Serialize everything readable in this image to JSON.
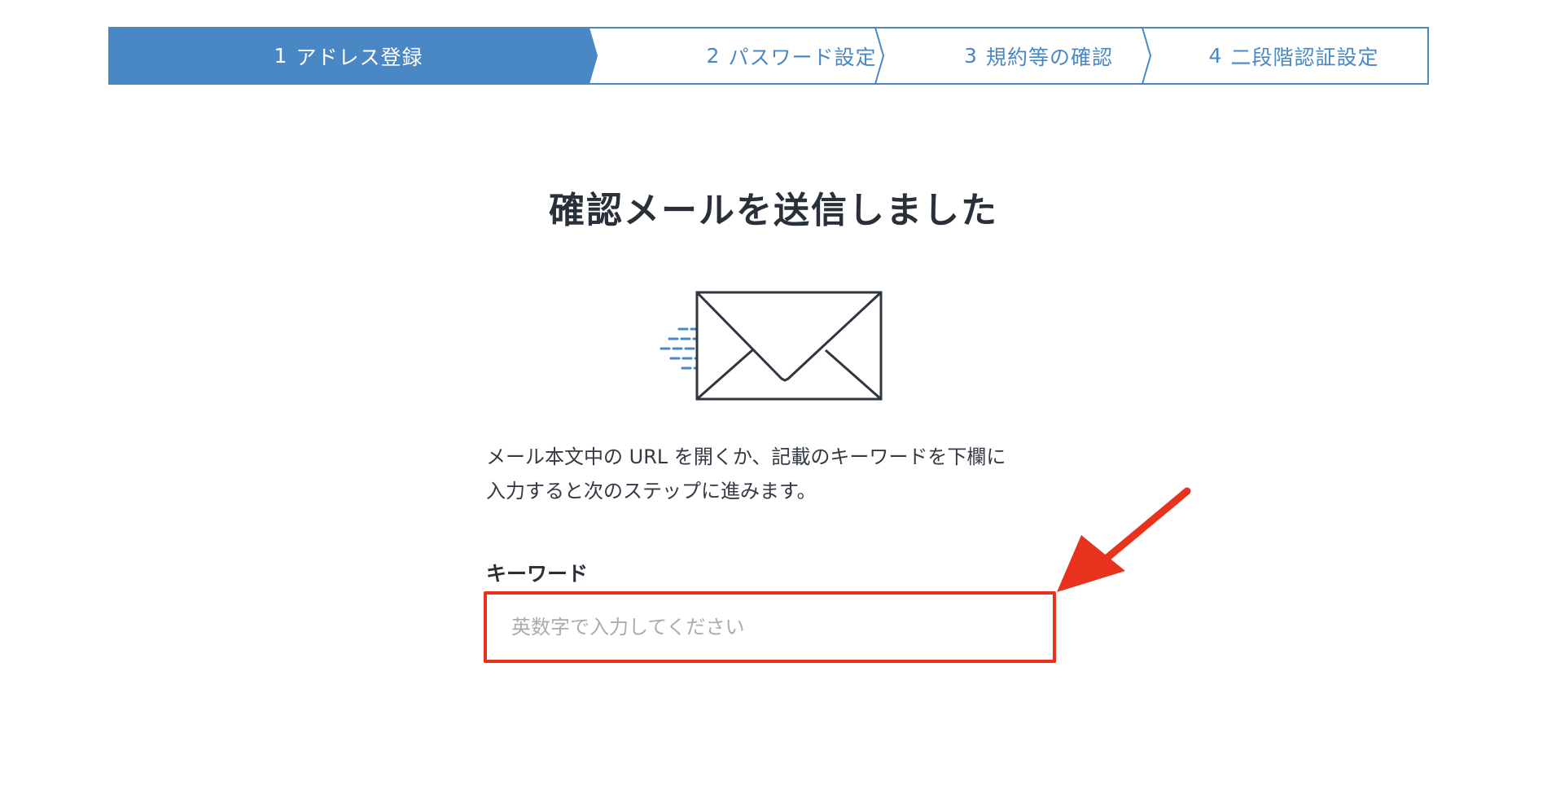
{
  "stepper": {
    "steps": [
      {
        "num": "1",
        "label": "アドレス登録",
        "active": true
      },
      {
        "num": "2",
        "label": "パスワード設定",
        "active": false
      },
      {
        "num": "3",
        "label": "規約等の確認",
        "active": false
      },
      {
        "num": "4",
        "label": "二段階認証設定",
        "active": false
      }
    ]
  },
  "main": {
    "title": "確認メールを送信しました",
    "envelope_icon": "mail-sent-icon",
    "description_line1": "メール本文中の URL を開くか、記載のキーワードを下欄に",
    "description_line2": "入力すると次のステップに進みます。",
    "keyword": {
      "label": "キーワード",
      "value": "",
      "placeholder": "英数字で入力してください"
    }
  },
  "annotation": {
    "arrow_icon": "red-pointer-arrow-icon",
    "highlight_color": "#e8321e"
  },
  "colors": {
    "accent": "#4a87c5",
    "highlight": "#e8321e"
  }
}
